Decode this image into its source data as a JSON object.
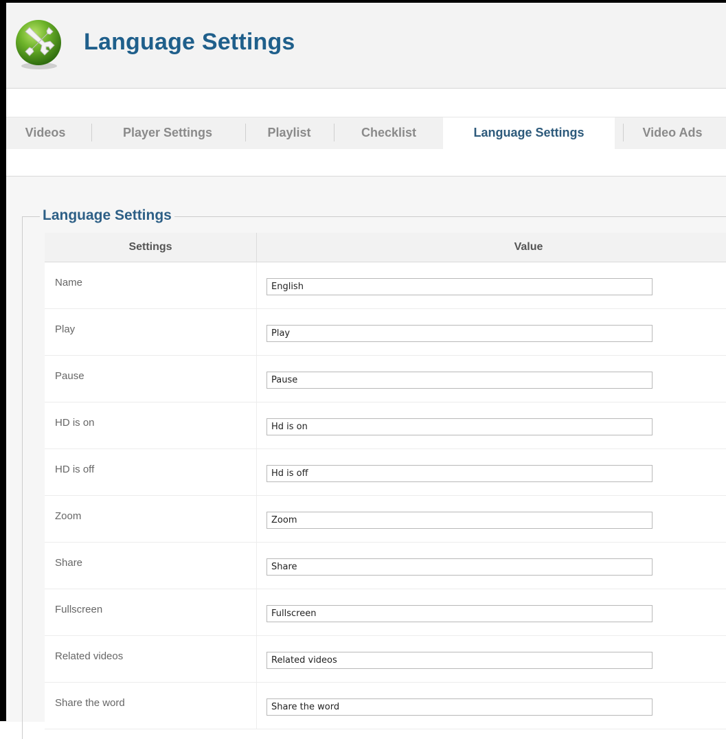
{
  "header": {
    "title": "Language Settings",
    "logo_icon": "tools-icon",
    "logo_color": "#5aa51c"
  },
  "tabs": [
    {
      "label": "Videos",
      "active": false
    },
    {
      "label": "Player Settings",
      "active": false
    },
    {
      "label": "Playlist",
      "active": false
    },
    {
      "label": "Checklist",
      "active": false
    },
    {
      "label": "Language Settings",
      "active": true
    },
    {
      "label": "Video Ads",
      "active": false
    }
  ],
  "section": {
    "legend": "Language Settings",
    "columns": {
      "settings": "Settings",
      "value": "Value"
    },
    "rows": [
      {
        "label": "Name",
        "value": "English"
      },
      {
        "label": "Play",
        "value": "Play"
      },
      {
        "label": "Pause",
        "value": "Pause"
      },
      {
        "label": "HD is on",
        "value": "Hd is on"
      },
      {
        "label": "HD is off",
        "value": "Hd is off"
      },
      {
        "label": "Zoom",
        "value": "Zoom"
      },
      {
        "label": "Share",
        "value": "Share"
      },
      {
        "label": "Fullscreen",
        "value": "Fullscreen"
      },
      {
        "label": "Related videos",
        "value": "Related videos"
      },
      {
        "label": "Share the word",
        "value": "Share the word"
      }
    ]
  },
  "colors": {
    "title": "#1f5f8b",
    "active_tab_text": "#2d5a7b",
    "inactive_tab_text": "#8a8a8a"
  }
}
